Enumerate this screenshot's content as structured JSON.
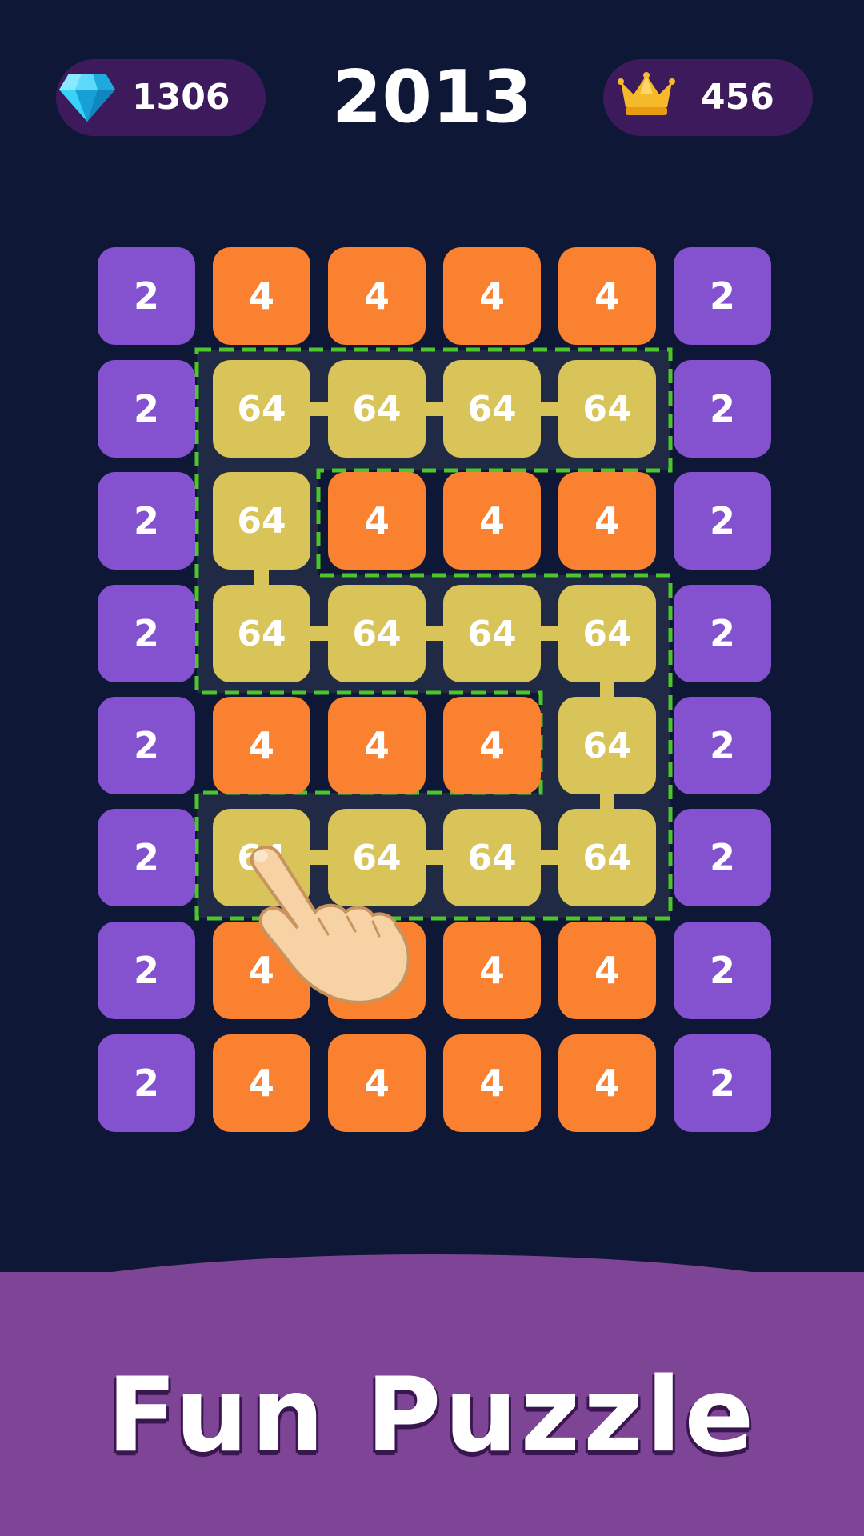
{
  "hud": {
    "gems": "1306",
    "gems_icon": "diamond-icon",
    "score": "2013",
    "best": "456",
    "best_icon": "crown-icon"
  },
  "board": {
    "rows": [
      [
        "2",
        "4",
        "4",
        "4",
        "4",
        "2"
      ],
      [
        "2",
        "64",
        "64",
        "64",
        "64",
        "2"
      ],
      [
        "2",
        "64",
        "4",
        "4",
        "4",
        "2"
      ],
      [
        "2",
        "64",
        "64",
        "64",
        "64",
        "2"
      ],
      [
        "2",
        "4",
        "4",
        "4",
        "64",
        "2"
      ],
      [
        "2",
        "64",
        "64",
        "64",
        "64",
        "2"
      ],
      [
        "2",
        "4",
        "4",
        "4",
        "4",
        "2"
      ],
      [
        "2",
        "4",
        "4",
        "4",
        "4",
        "2"
      ]
    ],
    "tile_colors": {
      "2": "#8552cf",
      "4": "#f98130",
      "64": "#d9c45a"
    },
    "selection_color": "#4cc62a",
    "selection_fill": "#28304a",
    "path": [
      [
        1,
        1
      ],
      [
        1,
        2
      ],
      [
        1,
        3
      ],
      [
        1,
        4
      ],
      [
        2,
        1
      ],
      [
        3,
        1
      ],
      [
        3,
        2
      ],
      [
        3,
        3
      ],
      [
        3,
        4
      ],
      [
        4,
        4
      ],
      [
        5,
        4
      ],
      [
        5,
        3
      ],
      [
        5,
        2
      ],
      [
        5,
        1
      ]
    ]
  },
  "hint": {
    "icon": "pointing-hand-icon"
  },
  "banner": {
    "title": "Fun Puzzle",
    "color": "#7e4596"
  }
}
